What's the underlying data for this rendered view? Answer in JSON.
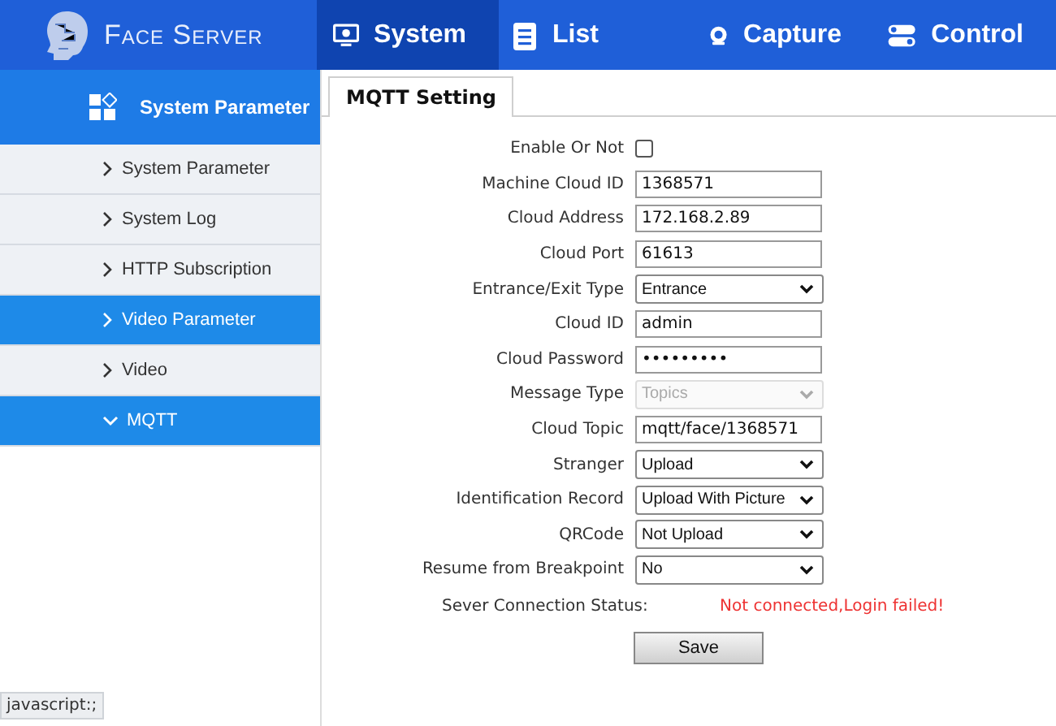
{
  "header": {
    "logo": "Face Server",
    "tabs": [
      {
        "label": "System",
        "selected": true
      },
      {
        "label": "List",
        "selected": false
      },
      {
        "label": "Capture",
        "selected": false
      },
      {
        "label": "Control",
        "selected": false
      }
    ]
  },
  "sidebar": {
    "title": "System Parameter",
    "items": [
      {
        "label": "System Parameter",
        "selected": false,
        "expanded": false
      },
      {
        "label": "System Log",
        "selected": false,
        "expanded": false
      },
      {
        "label": "HTTP Subscription",
        "selected": false,
        "expanded": false
      },
      {
        "label": "Video Parameter",
        "selected": true,
        "expanded": false
      },
      {
        "label": "Video",
        "selected": false,
        "expanded": false
      },
      {
        "label": "MQTT",
        "selected": true,
        "expanded": true
      }
    ]
  },
  "content": {
    "tab": "MQTT Setting",
    "fields": [
      {
        "label": "Enable Or Not",
        "kind": "checkbox",
        "checked": false
      },
      {
        "label": "Machine Cloud ID",
        "kind": "text",
        "value": "1368571"
      },
      {
        "label": "Cloud Address",
        "kind": "text",
        "value": "172.168.2.89"
      },
      {
        "label": "Cloud Port",
        "kind": "text",
        "value": "61613"
      },
      {
        "label": "Entrance/Exit Type",
        "kind": "select",
        "value": "Entrance",
        "disabled": false
      },
      {
        "label": "Cloud ID",
        "kind": "text",
        "value": "admin"
      },
      {
        "label": "Cloud Password",
        "kind": "text",
        "value": "•••••••••"
      },
      {
        "label": "Message Type",
        "kind": "select",
        "value": "Topics",
        "disabled": true
      },
      {
        "label": "Cloud Topic",
        "kind": "text",
        "value": "mqtt/face/1368571"
      },
      {
        "label": "Stranger",
        "kind": "select",
        "value": "Upload",
        "disabled": false
      },
      {
        "label": "Identification Record",
        "kind": "select",
        "value": "Upload With Picture",
        "disabled": false
      },
      {
        "label": "QRCode",
        "kind": "select",
        "value": "Not Upload",
        "disabled": false
      },
      {
        "label": "Resume from Breakpoint",
        "kind": "select",
        "value": "No",
        "disabled": false
      }
    ],
    "status": {
      "label": "Sever Connection Status:",
      "value": "Not connected,Login failed!"
    },
    "save_button": "Save"
  },
  "status_bar": "javascript:;"
}
